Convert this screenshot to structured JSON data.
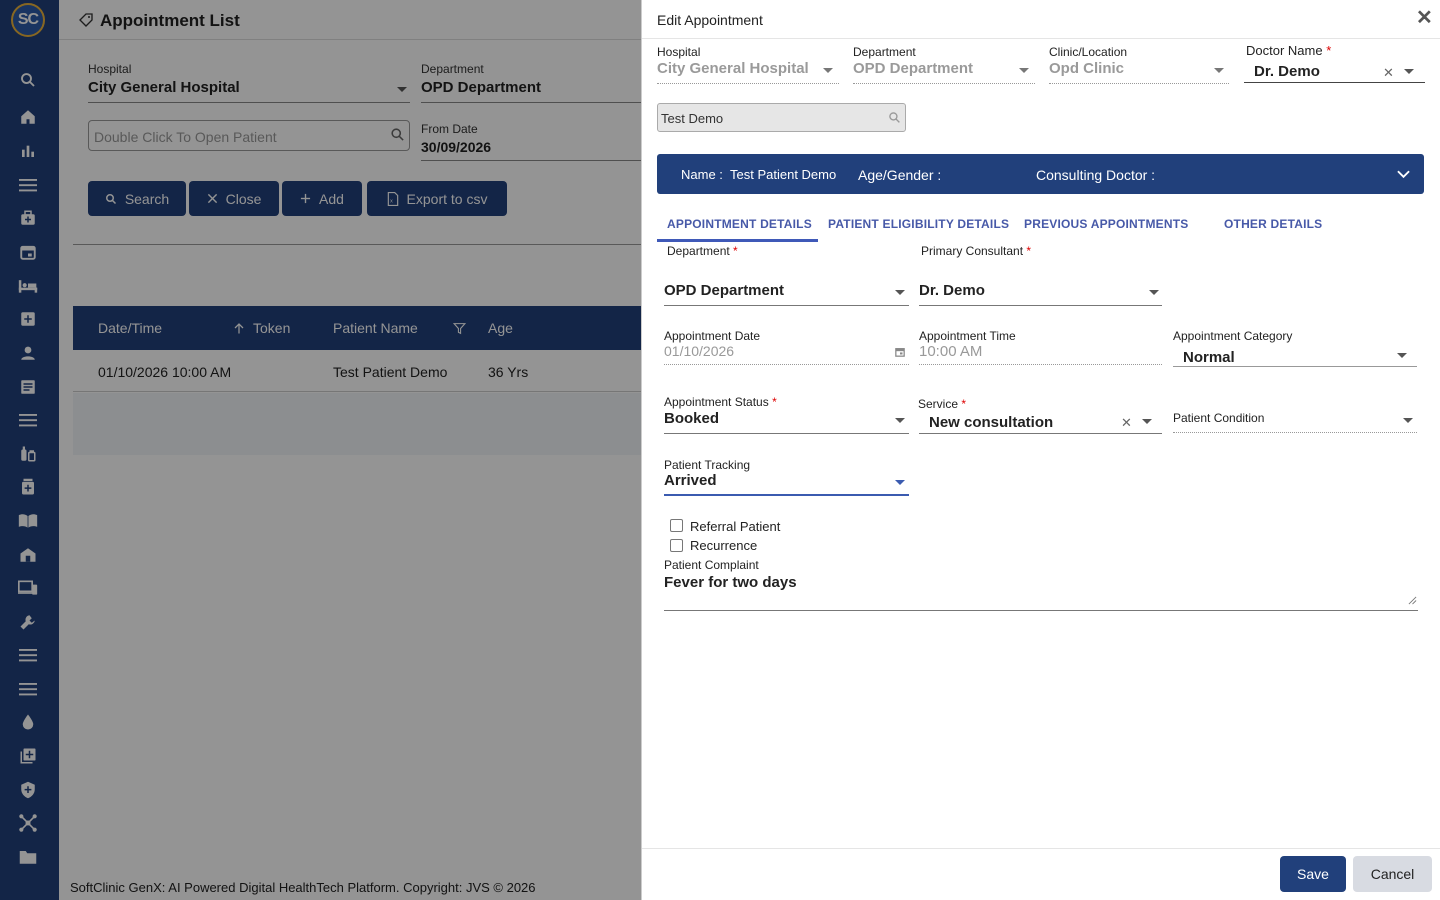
{
  "app": {
    "logo_text": "SC",
    "page_title": "Appointment List"
  },
  "sidebar": {
    "icons": [
      "search-icon",
      "home-icon",
      "chart-icon",
      "menu-icon",
      "medical-bag-icon",
      "calendar-icon",
      "bed-icon",
      "medical-plus-icon",
      "person-icon",
      "document-icon",
      "menu-icon",
      "pharmacy-icon",
      "medicine-icon",
      "book-icon",
      "building-icon",
      "devices-icon",
      "wrench-icon",
      "menu-icon",
      "menu-icon",
      "drop-icon",
      "add-box-icon",
      "shield-icon",
      "network-icon",
      "folder-icon"
    ]
  },
  "filters": {
    "hospital_label": "Hospital",
    "hospital_value": "City General Hospital",
    "department_label": "Department",
    "department_value": "OPD Department",
    "patient_placeholder": "Double Click To Open Patient",
    "from_date_label": "From Date",
    "from_date_value": "30/09/2026"
  },
  "actions": {
    "search": "Search",
    "close": "Close",
    "add": "Add",
    "export": "Export to csv"
  },
  "table": {
    "headers": [
      "Date/Time",
      "Token",
      "Patient Name",
      "Age"
    ],
    "rows": [
      [
        "01/10/2026 10:00 AM",
        "",
        "Test Patient Demo",
        "36 Yrs"
      ]
    ]
  },
  "footer": "SoftClinic GenX: AI Powered Digital HealthTech Platform. Copyright: JVS © 2026",
  "modal": {
    "title": "Edit Appointment",
    "hospital_label": "Hospital",
    "hospital_value": "City General Hospital",
    "department_label": "Department",
    "department_value": "OPD Department",
    "clinic_label": "Clinic/Location",
    "clinic_value": "Opd Clinic",
    "doctor_label": "Doctor Name",
    "doctor_value": "Dr. Demo",
    "patient_search_value": "Test Demo",
    "banner": {
      "name_label": "Name :",
      "name_value": "Test Patient Demo",
      "age_label": "Age/Gender :",
      "consulting_label": "Consulting Doctor :"
    },
    "tabs": [
      "APPOINTMENT DETAILS",
      "PATIENT ELIGIBILITY DETAILS",
      "PREVIOUS APPOINTMENTS",
      "OTHER DETAILS"
    ],
    "form": {
      "department_label": "Department",
      "department_value": "OPD Department",
      "consultant_label": "Primary Consultant",
      "consultant_value": "Dr. Demo",
      "appt_date_label": "Appointment Date",
      "appt_date_value": "01/10/2026",
      "appt_time_label": "Appointment Time",
      "appt_time_value": "10:00 AM",
      "category_label": "Appointment Category",
      "category_value": "Normal",
      "status_label": "Appointment Status",
      "status_value": "Booked",
      "service_label": "Service",
      "service_value": "New consultation",
      "condition_label": "Patient Condition",
      "tracking_label": "Patient Tracking",
      "tracking_value": "Arrived",
      "referral_label": "Referral Patient",
      "recurrence_label": "Recurrence",
      "complaint_label": "Patient Complaint",
      "complaint_value": "Fever for two days"
    },
    "save": "Save",
    "cancel": "Cancel"
  }
}
